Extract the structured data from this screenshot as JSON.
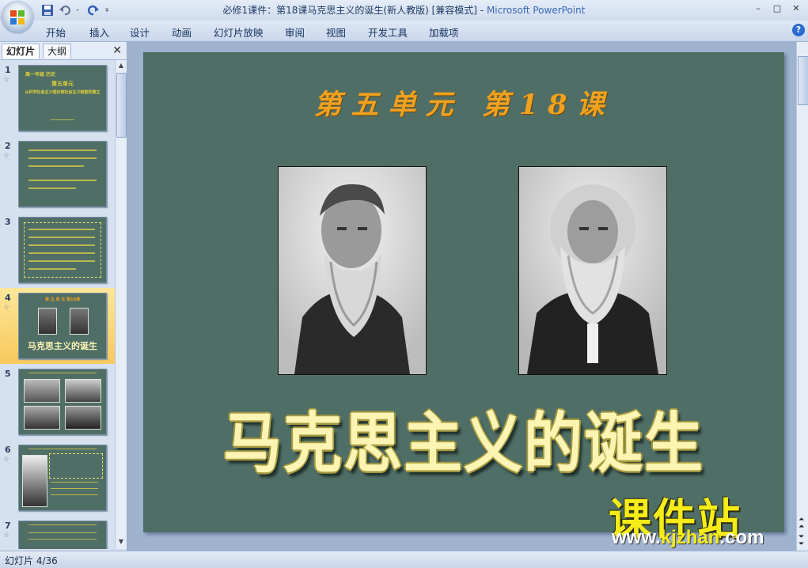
{
  "titlebar": {
    "document": "必修1课件：第18课马克思主义的诞生(新人教版) [兼容模式]",
    "separator": " - ",
    "app": "Microsoft PowerPoint"
  },
  "window_controls": {
    "minimize": "–",
    "maximize": "□",
    "close": "✕"
  },
  "ribbon": {
    "tabs": [
      "开始",
      "插入",
      "设计",
      "动画",
      "幻灯片放映",
      "审阅",
      "视图",
      "开发工具",
      "加载项"
    ],
    "help": "?"
  },
  "left_pane": {
    "tabs": [
      "幻灯片",
      "大纲"
    ],
    "close": "✕",
    "slides": [
      {
        "number": "1",
        "lines": [
          "高一年级  历史",
          "第五单元",
          "从科学社会主义理论到社会主义制度的建立"
        ]
      },
      {
        "number": "2"
      },
      {
        "number": "3"
      },
      {
        "number": "4",
        "title": "第 五 单 元     第18课",
        "caption": "马克思主义的诞生"
      },
      {
        "number": "5"
      },
      {
        "number": "6"
      },
      {
        "number": "7"
      }
    ],
    "selected_index": 3,
    "star": "☆"
  },
  "slide": {
    "unit_title": "第五单元    第18课",
    "main_title": "马克思主义的诞生"
  },
  "watermark": {
    "brand": "课件站",
    "url_prefix": "www.",
    "url_domain": "kjzhan",
    "url_suffix": ".com"
  },
  "status_bar": {
    "slide_indicator": "幻灯片 4/36"
  },
  "colors": {
    "slide_bg": "#4f6e66",
    "unit_title": "#f0a11e",
    "main_title": "#fbf4b3",
    "selection": "#f8c95c"
  }
}
